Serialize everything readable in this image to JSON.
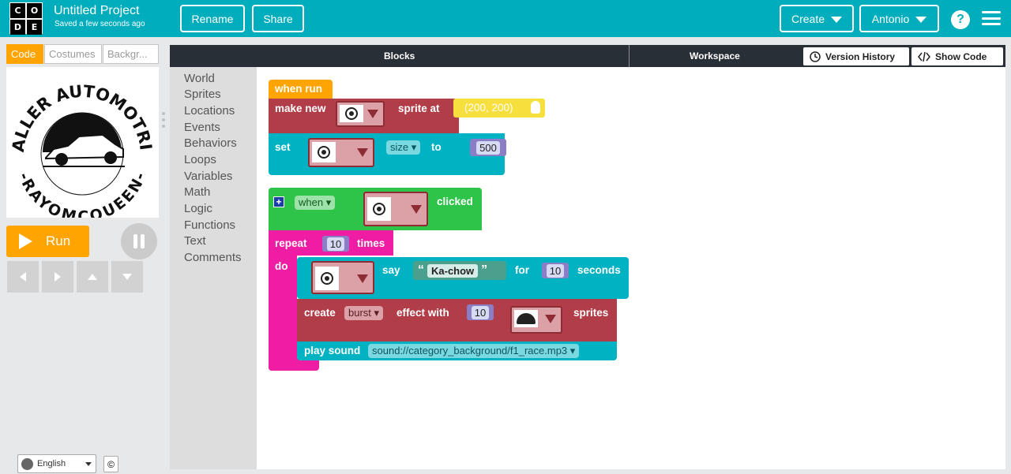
{
  "header": {
    "logo_letters": [
      "C",
      "O",
      "D",
      "E"
    ],
    "project_title": "Untitled Project",
    "save_status": "Saved a few seconds ago",
    "rename_label": "Rename",
    "share_label": "Share",
    "create_label": "Create",
    "user_label": "Antonio",
    "help_label": "?",
    "bg_color": "#00adbc"
  },
  "left_panel": {
    "tabs": [
      {
        "label": "Code",
        "active": true
      },
      {
        "label": "Costumes",
        "active": false
      },
      {
        "label": "Backgr...",
        "active": false
      }
    ],
    "stage_logo_text_top": "TALLER AUTOMOTRIZ",
    "stage_logo_text_bottom": "-RAYOMCQUEEN-",
    "run_label": "Run",
    "pause_icon": "pause-icon",
    "arrow_icons": [
      "arrow-left-icon",
      "arrow-right-icon",
      "arrow-up-icon",
      "arrow-down-icon"
    ],
    "language": "English",
    "copyright_label": "©"
  },
  "workspace": {
    "blocks_label": "Blocks",
    "workspace_label": "Workspace",
    "version_history_label": "Version History",
    "show_code_label": "Show Code"
  },
  "toolbox": {
    "categories": [
      "World",
      "Sprites",
      "Locations",
      "Events",
      "Behaviors",
      "Loops",
      "Variables",
      "Math",
      "Logic",
      "Functions",
      "Text",
      "Comments"
    ]
  },
  "blocks": {
    "when_run": "when run",
    "make_new": "make new",
    "sprite_at": "sprite at",
    "location": "(200, 200)",
    "set": "set",
    "size_prop": "size",
    "to": "to",
    "size_value": "500",
    "when_dropdown": "when",
    "clicked": "clicked",
    "plus": "+",
    "repeat": "repeat",
    "repeat_count": "10",
    "times": "times",
    "do": "do",
    "say": "say",
    "say_text": "Ka-chow",
    "for": "for",
    "say_seconds": "10",
    "seconds": "seconds",
    "create": "create",
    "effect": "burst",
    "effect_with": "effect with",
    "effect_count": "10",
    "sprites": "sprites",
    "play_sound": "play sound",
    "sound_file": "sound://category_background/f1_race.mp3"
  }
}
